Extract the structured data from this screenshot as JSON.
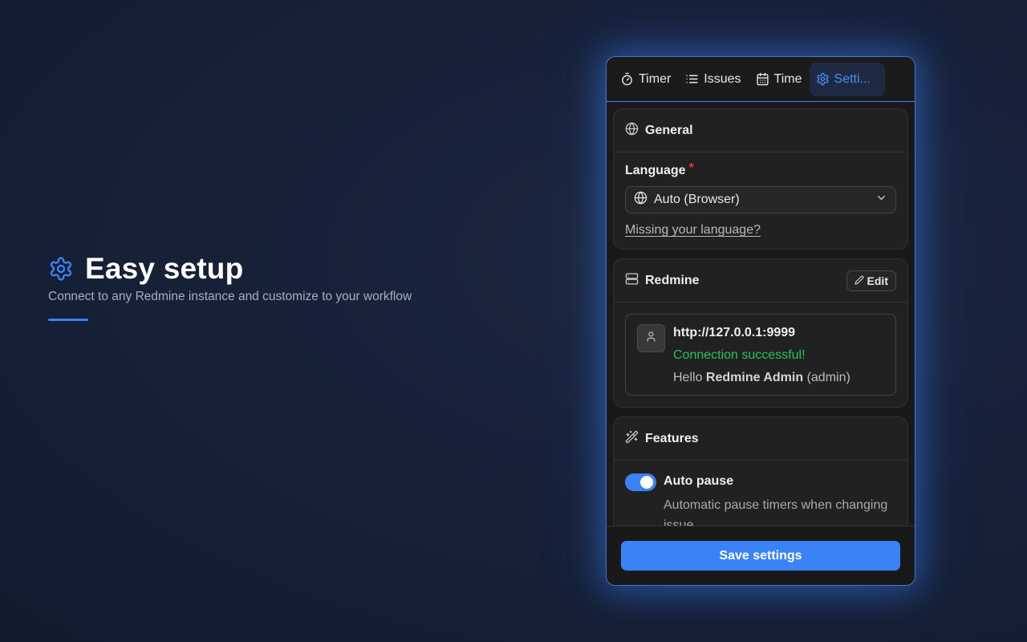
{
  "hero": {
    "icon": "gear-icon",
    "title": "Easy setup",
    "subtitle": "Connect to any Redmine instance and customize to your workflow",
    "accent": "#3b82f6"
  },
  "tabs": [
    {
      "label": "Timer",
      "icon": "stopwatch-icon",
      "active": false
    },
    {
      "label": "Issues",
      "icon": "list-icon",
      "active": false
    },
    {
      "label": "Time",
      "icon": "calendar-icon",
      "active": false
    },
    {
      "label": "Setti...",
      "icon": "gear-icon",
      "active": true
    }
  ],
  "general": {
    "title": "General",
    "language_label": "Language",
    "required_mark": "*",
    "language_value": "Auto (Browser)",
    "missing_link": "Missing your language?"
  },
  "redmine": {
    "title": "Redmine",
    "edit_label": "Edit",
    "url": "http://127.0.0.1:9999",
    "status": "Connection successful!",
    "hello_prefix": "Hello",
    "user_name": "Redmine Admin",
    "user_login": "(admin)"
  },
  "features": {
    "title": "Features",
    "items": [
      {
        "title": "Auto pause",
        "description": "Automatic pause timers when changing issue",
        "enabled": true
      }
    ]
  },
  "footer": {
    "save_label": "Save settings"
  },
  "colors": {
    "accent": "#3b82f6",
    "success": "#22c55e",
    "required": "#e53935"
  }
}
